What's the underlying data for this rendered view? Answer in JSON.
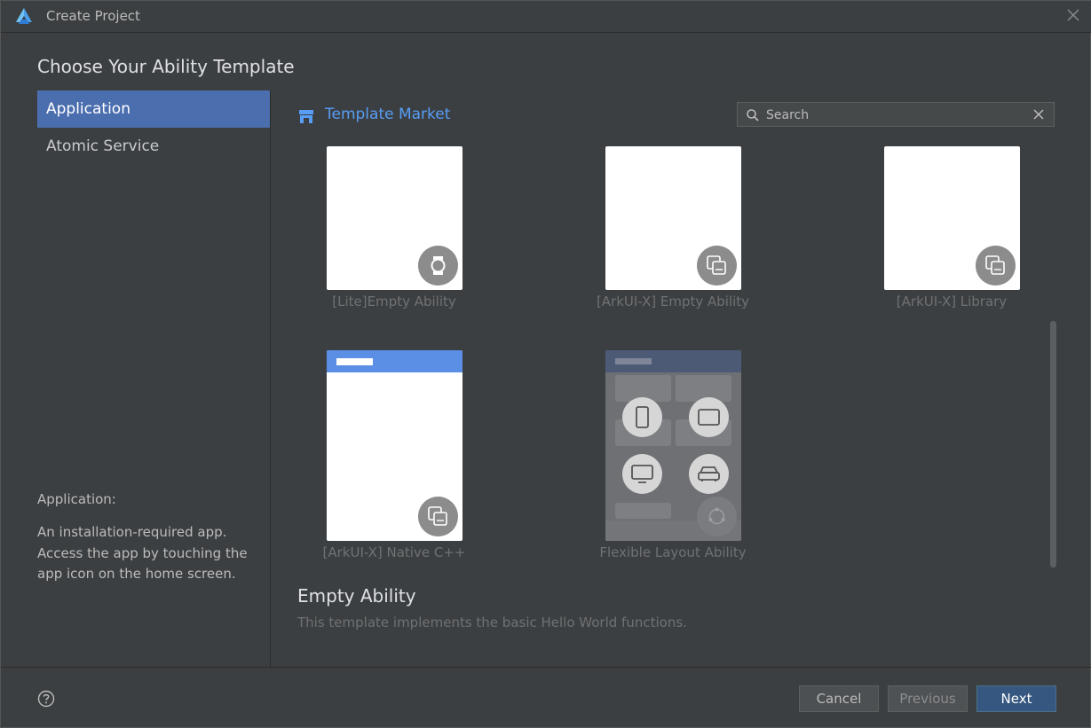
{
  "window": {
    "title": "Create Project"
  },
  "heading": "Choose Your Ability Template",
  "sidebar": {
    "items": [
      {
        "label": "Application",
        "selected": true
      },
      {
        "label": "Atomic Service",
        "selected": false
      }
    ]
  },
  "description": {
    "title": "Application:",
    "body": "An installation-required app. Access the app by touching the app icon on the home screen."
  },
  "market": {
    "label": "Template Market",
    "icon": "store-icon"
  },
  "search": {
    "placeholder": "Search",
    "value": ""
  },
  "templates": [
    {
      "label": "[Lite]Empty Ability",
      "badge_icon": "watch-icon"
    },
    {
      "label": "[ArkUI-X] Empty Ability",
      "badge_icon": "multi-device-icon"
    },
    {
      "label": "[ArkUI-X] Library",
      "badge_icon": "multi-device-icon"
    },
    {
      "label": "[ArkUI-X] Native C++",
      "badge_icon": "multi-device-icon"
    },
    {
      "label": "Flexible Layout Ability",
      "badge_icon": "devices-icon"
    }
  ],
  "selected_template": {
    "title": "Empty Ability",
    "description": "This template implements the basic Hello World functions."
  },
  "buttons": {
    "cancel": "Cancel",
    "previous": "Previous",
    "next": "Next"
  },
  "colors": {
    "accent": "#4b6eaf",
    "link": "#589df6",
    "primary_button": "#365880",
    "background": "#3c3f41"
  }
}
